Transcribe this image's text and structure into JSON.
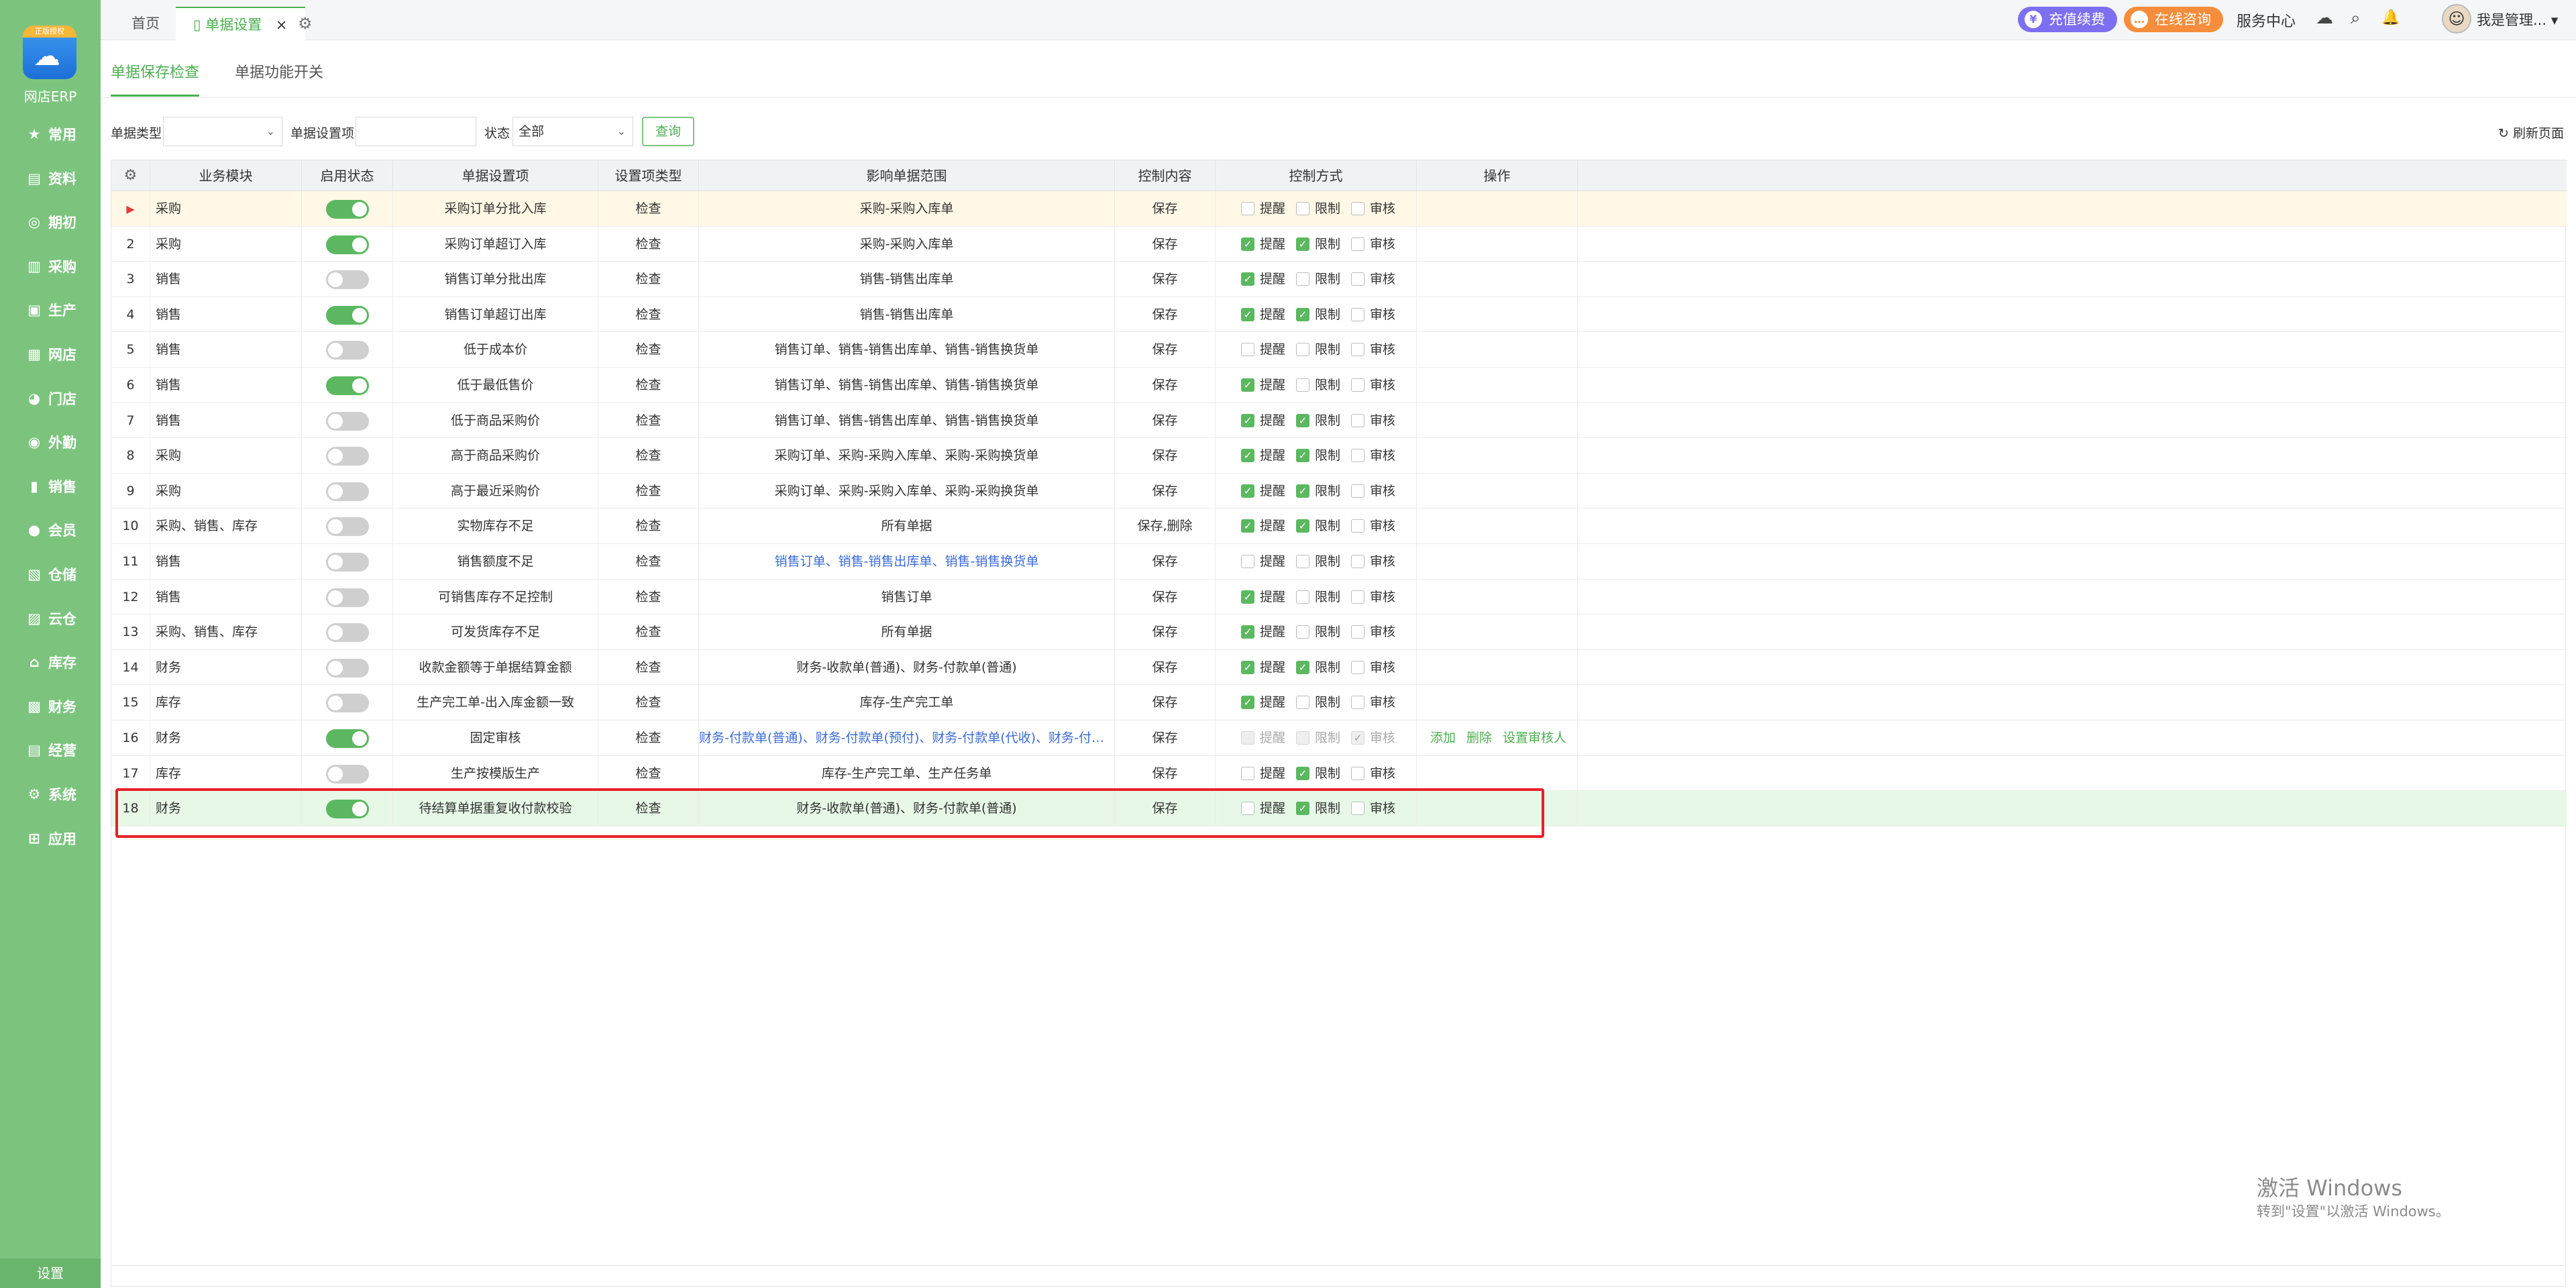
{
  "app": {
    "logo_badge": "正版授权",
    "logo_name": "网店ERP"
  },
  "sidebar": {
    "items": [
      {
        "label": "常用",
        "icon": "star-icon",
        "glyph": "★"
      },
      {
        "label": "资料",
        "icon": "document-icon",
        "glyph": "▤"
      },
      {
        "label": "期初",
        "icon": "target-icon",
        "glyph": "◎"
      },
      {
        "label": "采购",
        "icon": "purchase-icon",
        "glyph": "▥"
      },
      {
        "label": "生产",
        "icon": "production-icon",
        "glyph": "▣"
      },
      {
        "label": "网店",
        "icon": "shop-icon",
        "glyph": "▦"
      },
      {
        "label": "门店",
        "icon": "store-icon",
        "glyph": "◕"
      },
      {
        "label": "外勤",
        "icon": "field-icon",
        "glyph": "◉"
      },
      {
        "label": "销售",
        "icon": "sales-icon",
        "glyph": "▮"
      },
      {
        "label": "会员",
        "icon": "member-icon",
        "glyph": "●"
      },
      {
        "label": "仓储",
        "icon": "warehouse-icon",
        "glyph": "▧"
      },
      {
        "label": "云仓",
        "icon": "cloud-warehouse-icon",
        "glyph": "▨"
      },
      {
        "label": "库存",
        "icon": "inventory-icon",
        "glyph": "⌂"
      },
      {
        "label": "财务",
        "icon": "finance-icon",
        "glyph": "▩"
      },
      {
        "label": "经营",
        "icon": "business-icon",
        "glyph": "▤"
      },
      {
        "label": "系统",
        "icon": "system-icon",
        "glyph": "⚙"
      },
      {
        "label": "应用",
        "icon": "apps-icon",
        "glyph": "⊞"
      }
    ],
    "settings_label": "设置"
  },
  "topbar": {
    "tab_home": "首页",
    "tab_active": "单据设置",
    "tab_close": "×",
    "tab_gear": "⚙",
    "recharge": "充值续费",
    "recharge_glyph": "¥",
    "consult": "在线咨询",
    "consult_glyph": "…",
    "service_center": "服务中心",
    "cloud_glyph": "☁",
    "search_glyph": "⌕",
    "bell_glyph": "🔔",
    "avatar_glyph": "☺",
    "user_name": "我是管理... ▾"
  },
  "subtabs": {
    "tab1": "单据保存检查",
    "tab2": "单据功能开关"
  },
  "filters": {
    "doc_type_label": "单据类型",
    "doc_type_value": "",
    "item_label": "单据设置项",
    "item_value": "",
    "status_label": "状态",
    "status_value": "全部",
    "caret": "⌄",
    "query": "查询",
    "refresh": "↻ 刷新页面"
  },
  "table": {
    "headers": {
      "gear": "⚙",
      "module": "业务模块",
      "status": "启用状态",
      "item": "单据设置项",
      "type": "设置项类型",
      "scope": "影响单据范围",
      "content": "控制内容",
      "mode": "控制方式",
      "ops": "操作"
    },
    "check_labels": {
      "remind": "提醒",
      "limit": "限制",
      "audit": "审核"
    },
    "check_glyph": "✓",
    "row_marker": "▶",
    "ops_labels": {
      "add": "添加",
      "delete": "删除",
      "set_auditor": "设置审核人"
    },
    "rows": [
      {
        "idx": "1",
        "module": "采购",
        "on": true,
        "item": "采购订单分批入库",
        "type": "检查",
        "scope": "采购-采购入库单",
        "content": "保存",
        "remind": false,
        "limit": false,
        "audit": false
      },
      {
        "idx": "2",
        "module": "采购",
        "on": true,
        "item": "采购订单超订入库",
        "type": "检查",
        "scope": "采购-采购入库单",
        "content": "保存",
        "remind": true,
        "limit": true,
        "audit": false
      },
      {
        "idx": "3",
        "module": "销售",
        "on": false,
        "item": "销售订单分批出库",
        "type": "检查",
        "scope": "销售-销售出库单",
        "content": "保存",
        "remind": true,
        "limit": false,
        "audit": false
      },
      {
        "idx": "4",
        "module": "销售",
        "on": true,
        "item": "销售订单超订出库",
        "type": "检查",
        "scope": "销售-销售出库单",
        "content": "保存",
        "remind": true,
        "limit": true,
        "audit": false
      },
      {
        "idx": "5",
        "module": "销售",
        "on": false,
        "item": "低于成本价",
        "type": "检查",
        "scope": "销售订单、销售-销售出库单、销售-销售换货单",
        "content": "保存",
        "remind": false,
        "limit": false,
        "audit": false
      },
      {
        "idx": "6",
        "module": "销售",
        "on": true,
        "item": "低于最低售价",
        "type": "检查",
        "scope": "销售订单、销售-销售出库单、销售-销售换货单",
        "content": "保存",
        "remind": true,
        "limit": false,
        "audit": false
      },
      {
        "idx": "7",
        "module": "销售",
        "on": false,
        "item": "低于商品采购价",
        "type": "检查",
        "scope": "销售订单、销售-销售出库单、销售-销售换货单",
        "content": "保存",
        "remind": true,
        "limit": true,
        "audit": false
      },
      {
        "idx": "8",
        "module": "采购",
        "on": false,
        "item": "高于商品采购价",
        "type": "检查",
        "scope": "采购订单、采购-采购入库单、采购-采购换货单",
        "content": "保存",
        "remind": true,
        "limit": true,
        "audit": false
      },
      {
        "idx": "9",
        "module": "采购",
        "on": false,
        "item": "高于最近采购价",
        "type": "检查",
        "scope": "采购订单、采购-采购入库单、采购-采购换货单",
        "content": "保存",
        "remind": true,
        "limit": true,
        "audit": false
      },
      {
        "idx": "10",
        "module": "采购、销售、库存",
        "on": false,
        "item": "实物库存不足",
        "type": "检查",
        "scope": "所有单据",
        "content": "保存,删除",
        "remind": true,
        "limit": true,
        "audit": false
      },
      {
        "idx": "11",
        "module": "销售",
        "on": false,
        "item": "销售额度不足",
        "type": "检查",
        "scope": "销售订单、销售-销售出库单、销售-销售换货单",
        "link": true,
        "content": "保存",
        "remind": false,
        "limit": false,
        "audit": false
      },
      {
        "idx": "12",
        "module": "销售",
        "on": false,
        "item": "可销售库存不足控制",
        "type": "检查",
        "scope": "销售订单",
        "content": "保存",
        "remind": true,
        "limit": false,
        "audit": false
      },
      {
        "idx": "13",
        "module": "采购、销售、库存",
        "on": false,
        "item": "可发货库存不足",
        "type": "检查",
        "scope": "所有单据",
        "content": "保存",
        "remind": true,
        "limit": false,
        "audit": false
      },
      {
        "idx": "14",
        "module": "财务",
        "on": false,
        "item": "收款金额等于单据结算金额",
        "type": "检查",
        "scope": "财务-收款单(普通)、财务-付款单(普通)",
        "content": "保存",
        "remind": true,
        "limit": true,
        "audit": false
      },
      {
        "idx": "15",
        "module": "库存",
        "on": false,
        "item": "生产完工单-出入库金额一致",
        "type": "检查",
        "scope": "库存-生产完工单",
        "content": "保存",
        "remind": true,
        "limit": false,
        "audit": false
      },
      {
        "idx": "16",
        "module": "财务",
        "on": true,
        "item": "固定审核",
        "type": "检查",
        "scope": "财务-付款单(普通)、财务-付款单(预付)、财务-付款单(代收)、财务-付款...",
        "link": true,
        "content": "保存",
        "remind": false,
        "limit": false,
        "audit": true,
        "disabled": true,
        "ops": true
      },
      {
        "idx": "17",
        "module": "库存",
        "on": false,
        "item": "生产按模版生产",
        "type": "检查",
        "scope": "库存-生产完工单、生产任务单",
        "content": "保存",
        "remind": false,
        "limit": true,
        "audit": false
      },
      {
        "idx": "18",
        "module": "财务",
        "on": true,
        "item": "待结算单据重复收付款校验",
        "type": "检查",
        "scope": "财务-收款单(普通)、财务-付款单(普通)",
        "content": "保存",
        "remind": false,
        "limit": true,
        "audit": false,
        "selected": true
      }
    ]
  },
  "watermark": {
    "line1": "激活 Windows",
    "line2": "转到\"设置\"以激活 Windows。"
  },
  "colors": {
    "sidebar": "#7cc47e",
    "accent": "#4caf50",
    "toggle_on": "#5cb860",
    "highlight": "#e8202a",
    "link": "#3b6bd9"
  }
}
